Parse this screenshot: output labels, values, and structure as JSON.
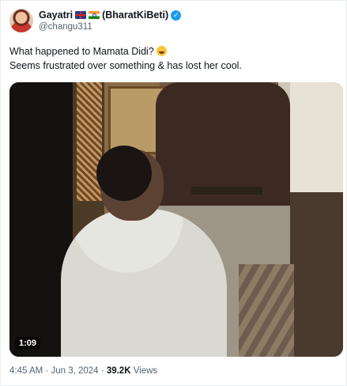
{
  "author": {
    "display_name": "Gayatri",
    "display_name_suffix": "(BharatKiBeti)",
    "handle": "@changu311",
    "flags": [
      "uk-flag",
      "india-flag"
    ],
    "avatar": "avatar-photo",
    "verified_badge": "verified-check-icon"
  },
  "tweet": {
    "line1": "What happened to Mamata Didi?",
    "line1_emoji": "rolling-on-floor-laughing-emoji",
    "line2": "Seems frustrated over something & has lost her cool."
  },
  "video": {
    "duration": "1:09"
  },
  "meta": {
    "time": "4:45 AM",
    "separator1": "·",
    "date": "Jun 3, 2024",
    "separator2": "·",
    "views_count": "39.2K",
    "views_label": "Views"
  },
  "colors": {
    "text": "#0f1419",
    "muted": "#536471",
    "verified": "#1d9bf0",
    "border": "#e8ebed"
  }
}
